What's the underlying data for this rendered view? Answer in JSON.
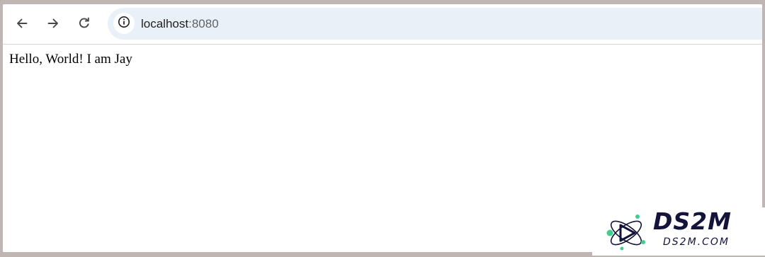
{
  "toolbar": {
    "back_icon": "arrow-left-icon",
    "forward_icon": "arrow-right-icon",
    "reload_icon": "reload-icon"
  },
  "address_bar": {
    "site_info_icon": "info-circle-icon",
    "host": "localhost",
    "port": ":8080"
  },
  "page": {
    "text": "Hello, World! I am Jay"
  },
  "watermark": {
    "title": "DS2M",
    "subtitle": "DS2M.COM"
  },
  "colors": {
    "omnibox_bg": "#eaf0f8",
    "icon_color": "#474747",
    "watermark_dark": "#14133a",
    "watermark_green": "#3ecf8e"
  }
}
